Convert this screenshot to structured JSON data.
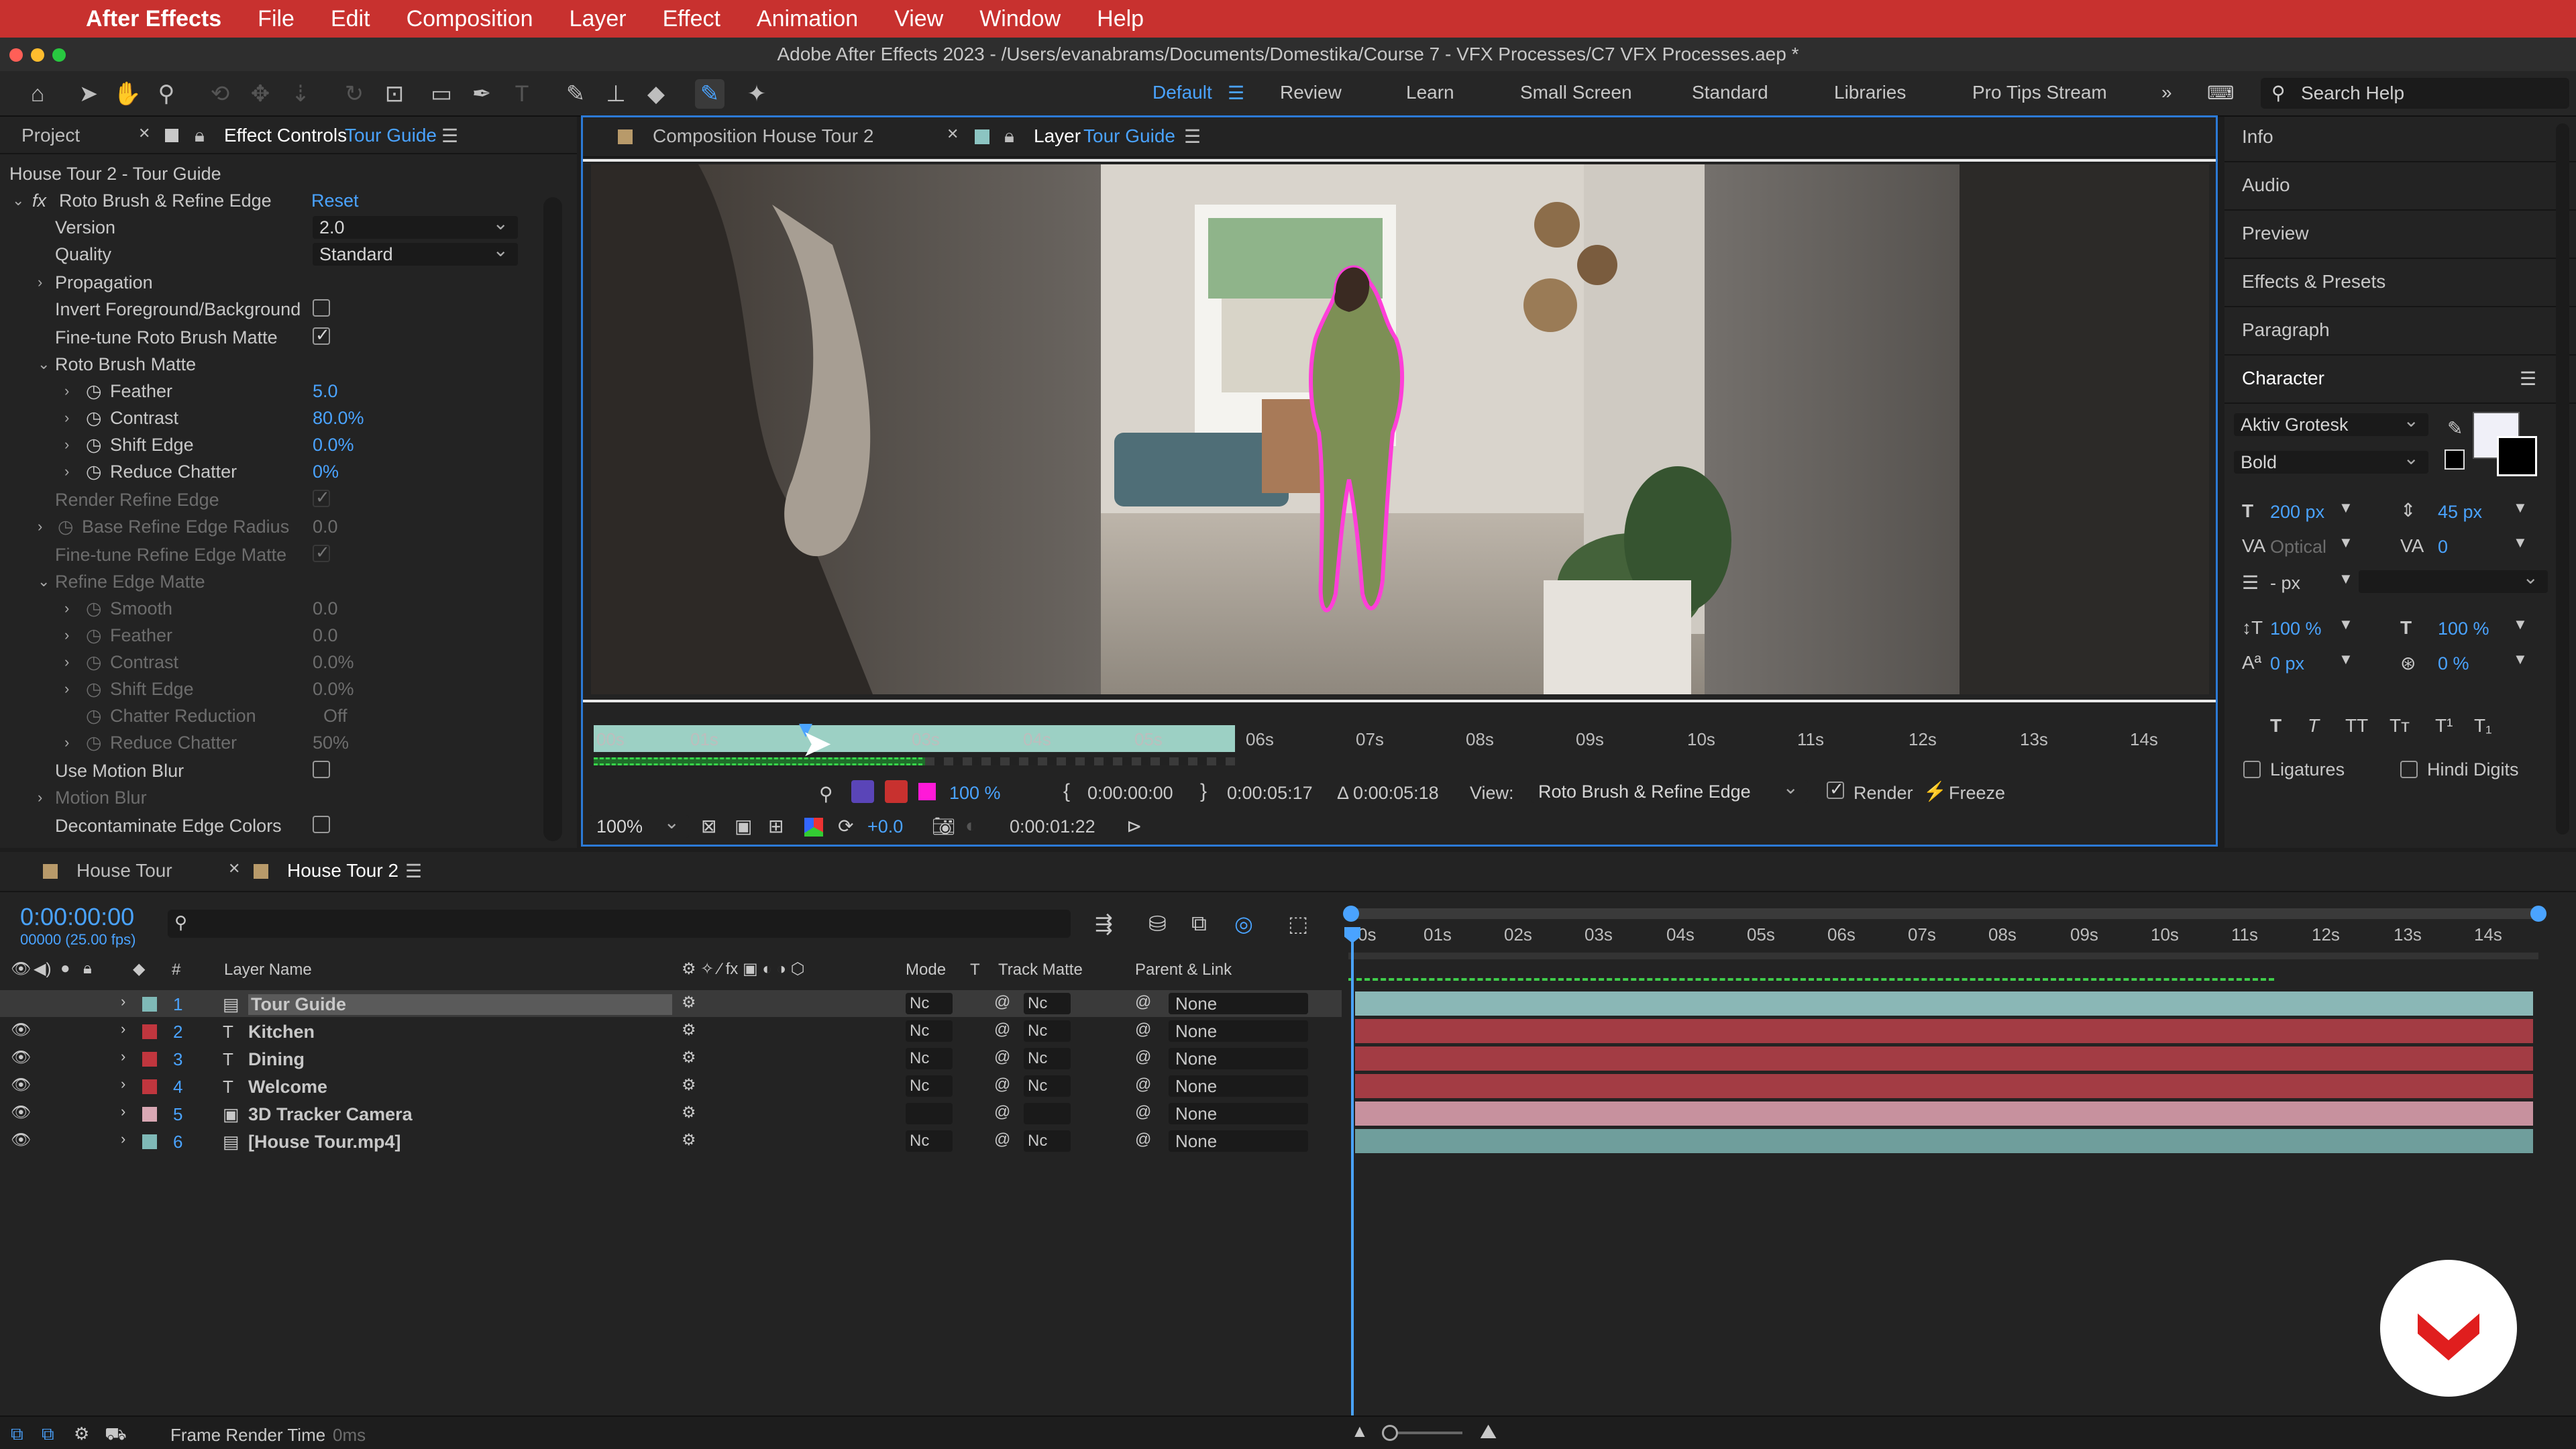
{
  "menubar": {
    "app": "After Effects",
    "items": [
      "File",
      "Edit",
      "Composition",
      "Layer",
      "Effect",
      "Animation",
      "View",
      "Window",
      "Help"
    ]
  },
  "window_title": "Adobe After Effects 2023 - /Users/evanabrams/Documents/Domestika/Course 7 - VFX Processes/C7 VFX Processes.aep *",
  "workspaces": {
    "items": [
      "Default",
      "Review",
      "Learn",
      "Small Screen",
      "Standard",
      "Libraries",
      "Pro Tips Stream"
    ],
    "active": "Default",
    "search_placeholder": "Search Help"
  },
  "effect_panel": {
    "tab_project": "Project",
    "tab_effect_controls": "Effect Controls",
    "tab_layer": "Tour Guide",
    "breadcrumb": "House Tour 2 - Tour Guide",
    "effect_name": "Roto Brush & Refine Edge",
    "reset": "Reset",
    "version_label": "Version",
    "version_value": "2.0",
    "quality_label": "Quality",
    "quality_value": "Standard",
    "propagation": "Propagation",
    "invert": "Invert Foreground/Background",
    "finetune": "Fine-tune Roto Brush Matte",
    "roto_matte": "Roto Brush Matte",
    "feather": "Feather",
    "feather_val": "5.0",
    "contrast": "Contrast",
    "contrast_val": "80.0%",
    "shift": "Shift Edge",
    "shift_val": "0.0%",
    "reduce": "Reduce Chatter",
    "reduce_val": "0%",
    "render_refine": "Render Refine Edge",
    "base_radius": "Base Refine Edge Radius",
    "base_radius_val": "0.0",
    "finetune_refine": "Fine-tune Refine Edge Matte",
    "refine_matte": "Refine Edge Matte",
    "smooth": "Smooth",
    "smooth_val": "0.0",
    "r_feather": "Feather",
    "r_feather_val": "0.0",
    "r_contrast": "Contrast",
    "r_contrast_val": "0.0%",
    "r_shift": "Shift Edge",
    "r_shift_val": "0.0%",
    "chatter_red": "Chatter Reduction",
    "chatter_red_val": "Off",
    "r_reduce": "Reduce Chatter",
    "r_reduce_val": "50%",
    "motion_blur": "Use Motion Blur",
    "motion_blur2": "Motion Blur",
    "decontam": "Decontaminate Edge Colors"
  },
  "viewer": {
    "tab_comp": "Composition House Tour 2",
    "tab_layer_prefix": "Layer",
    "tab_layer_name": "Tour Guide",
    "ruler_ticks": [
      "00s",
      "01s",
      "03s",
      "04s",
      "05s",
      "06s",
      "07s",
      "08s",
      "09s",
      "10s",
      "11s",
      "12s",
      "13s",
      "14s"
    ],
    "zoom_pct": "100 %",
    "in_time": "0:00:00:00",
    "out_time": "0:00:05:17",
    "duration": "Δ 0:00:05:18",
    "view_label": "View:",
    "view_value": "Roto Brush & Refine Edge",
    "render_label": "Render",
    "freeze_label": "Freeze",
    "magnification": "100%",
    "exposure": "+0.0",
    "current_time": "0:00:01:22"
  },
  "right_panel": {
    "items": [
      "Info",
      "Audio",
      "Preview",
      "Effects & Presets",
      "Paragraph",
      "Character"
    ],
    "font": "Aktiv Grotesk",
    "style": "Bold",
    "size": "200 px",
    "leading": "45 px",
    "kerning": "Optical",
    "tracking": "0",
    "stroke": "- px",
    "vscale": "100 %",
    "hscale": "100 %",
    "baseline": "0 px",
    "tsume": "0 %",
    "ligatures": "Ligatures",
    "hindi": "Hindi Digits",
    "fill_color": "#f0f0f8",
    "stroke_color": "#000000"
  },
  "timeline": {
    "tab1": "House Tour",
    "tab2": "House Tour 2",
    "timecode": "0:00:00:00",
    "fps": "00000 (25.00 fps)",
    "col_num": "#",
    "col_name": "Layer Name",
    "col_mode": "Mode",
    "col_t": "T",
    "col_matte": "Track Matte",
    "col_parent": "Parent & Link",
    "ticks": [
      "0s",
      "01s",
      "02s",
      "03s",
      "04s",
      "05s",
      "06s",
      "07s",
      "08s",
      "09s",
      "10s",
      "11s",
      "12s",
      "13s",
      "14s"
    ],
    "layers": [
      {
        "num": "1",
        "type": "▤",
        "name": "Tour Guide",
        "color": "#7fb9b7",
        "mode": "Nc",
        "matte": "Nc",
        "parent": "None",
        "bar": "#8ab7b6"
      },
      {
        "num": "2",
        "type": "T",
        "name": "Kitchen",
        "color": "#c0363e",
        "mode": "Nc",
        "matte": "Nc",
        "parent": "None",
        "bar": "#a33c44"
      },
      {
        "num": "3",
        "type": "T",
        "name": "Dining",
        "color": "#c0363e",
        "mode": "Nc",
        "matte": "Nc",
        "parent": "None",
        "bar": "#a33c44"
      },
      {
        "num": "4",
        "type": "T",
        "name": "Welcome",
        "color": "#c0363e",
        "mode": "Nc",
        "matte": "Nc",
        "parent": "None",
        "bar": "#a33c44"
      },
      {
        "num": "5",
        "type": "▣",
        "name": "3D Tracker Camera",
        "color": "#d9a8b4",
        "mode": "",
        "matte": "",
        "parent": "None",
        "bar": "#c7919e"
      },
      {
        "num": "6",
        "type": "▤",
        "name": "[House Tour.mp4]",
        "color": "#7fb9b7",
        "mode": "Nc",
        "matte": "Nc",
        "parent": "None",
        "bar": "#6f9e9c"
      }
    ]
  },
  "status": {
    "label": "Frame Render Time",
    "value": "0ms"
  }
}
